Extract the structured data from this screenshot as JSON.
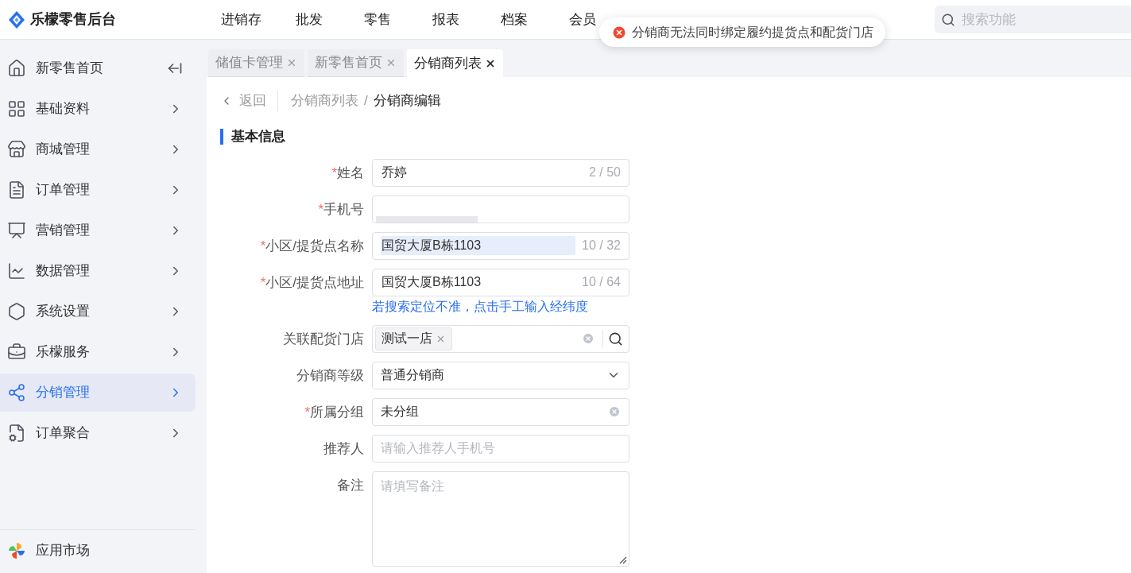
{
  "brand": {
    "name": "乐檬零售后台"
  },
  "top_nav": [
    {
      "label": "进销存"
    },
    {
      "label": "批发"
    },
    {
      "label": "零售"
    },
    {
      "label": "报表"
    },
    {
      "label": "档案"
    },
    {
      "label": "会员"
    }
  ],
  "search": {
    "placeholder": "搜索功能"
  },
  "toast": {
    "kind": "error",
    "message": "分销商无法同时绑定履约提货点和配货门店"
  },
  "sidebar": {
    "items": [
      {
        "label": "新零售首页",
        "selected": false,
        "kind": "collapse"
      },
      {
        "label": "基础资料",
        "selected": false,
        "kind": "menu"
      },
      {
        "label": "商城管理",
        "selected": false,
        "kind": "menu"
      },
      {
        "label": "订单管理",
        "selected": false,
        "kind": "menu"
      },
      {
        "label": "营销管理",
        "selected": false,
        "kind": "menu"
      },
      {
        "label": "数据管理",
        "selected": false,
        "kind": "menu"
      },
      {
        "label": "系统设置",
        "selected": false,
        "kind": "menu"
      },
      {
        "label": "乐檬服务",
        "selected": false,
        "kind": "menu"
      },
      {
        "label": "分销管理",
        "selected": true,
        "kind": "menu"
      },
      {
        "label": "订单聚合",
        "selected": false,
        "kind": "menu"
      }
    ],
    "footer": {
      "label": "应用市场"
    }
  },
  "tabs": [
    {
      "label": "储值卡管理",
      "selected": false
    },
    {
      "label": "新零售首页",
      "selected": false
    },
    {
      "label": "分销商列表",
      "selected": true
    }
  ],
  "breadcrumb": {
    "back": "返回",
    "separator": "/",
    "items": [
      "分销商列表",
      "分销商编辑"
    ]
  },
  "section_title": "基本信息",
  "form": [
    {
      "label": "姓名",
      "required_mark": "*",
      "kind": "text",
      "value": "乔婷",
      "count": "2 / 50"
    },
    {
      "label": "手机号",
      "required_mark": "*",
      "kind": "redacted"
    },
    {
      "label": "小区/提货点名称",
      "required_mark": "*",
      "kind": "text",
      "value": "国贸大厦B栋1103",
      "count": "10 / 32",
      "highlighted": true
    },
    {
      "label": "小区/提货点地址",
      "required_mark": "*",
      "kind": "text",
      "value": "国贸大厦B栋1103",
      "count": "10 / 64",
      "link": "若搜索定位不准，点击手工输入经纬度"
    },
    {
      "label": "关联配货门店",
      "kind": "tags",
      "tags": [
        "测试一店"
      ]
    },
    {
      "label": "分销商等级",
      "kind": "select",
      "value": "普通分销商"
    },
    {
      "label": "所属分组",
      "required_mark": "*",
      "kind": "clearable",
      "value": "未分组"
    },
    {
      "label": "推荐人",
      "kind": "text",
      "placeholder": "请输入推荐人手机号"
    },
    {
      "label": "备注",
      "kind": "textarea",
      "placeholder": "请填写备注"
    }
  ]
}
